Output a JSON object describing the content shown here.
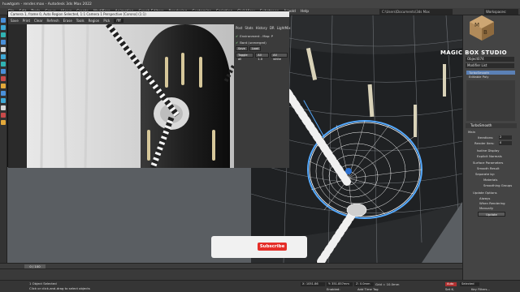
{
  "window": {
    "title": "huwtgom - render.max - Autodesk 3ds Max 2022",
    "menus": [
      "File",
      "Edit",
      "Tools",
      "Group",
      "Views",
      "Create",
      "Modifiers",
      "Animation",
      "Graph Editors",
      "Rendering",
      "Customize",
      "Scripting",
      "Civil View",
      "Substance",
      "Arnold",
      "Help"
    ],
    "project_path": "C:\\Users\\Documents\\3ds Max",
    "workspace": "Workspaces: Default"
  },
  "render_window": {
    "title": "Camera 1, frame 0, Auto Region Selected, 1:1 Camera 1 Perspective [Corona] (1:1)",
    "tools": [
      "Save",
      "Print",
      "Clear",
      "Refresh",
      "Erase",
      "Tools",
      "Region",
      "Pick"
    ],
    "pick_value": "ffff",
    "panel_tabs": [
      "Post",
      "Stats",
      "History",
      "DR",
      "LightMix"
    ],
    "rows": [
      "Environment - Map: P",
      "Bard (unmerged)"
    ],
    "buttons": [
      "Save",
      "Load"
    ],
    "buttons2": [
      "Toggle all",
      "All 1.0",
      "All white"
    ]
  },
  "logo": {
    "text": "MAGIC BOX STUDIO"
  },
  "command_panel": {
    "object_name": "Object074",
    "modifier_list": "Modifier List",
    "stack": [
      "TurboSmooth",
      "Editable Poly"
    ],
    "rollout_title": "TurboSmooth",
    "main_label": "Main",
    "iterations_label": "Iterations:",
    "iterations_value": "2",
    "render_iters_label": "Render Iters:",
    "render_iters_value": "0",
    "isoline_display": "Isoline Display",
    "explicit_normals": "Explicit Normals",
    "surface_params": "Surface Parameters",
    "smooth_result": "Smooth Result",
    "separate_by": "Separate by:",
    "materials": "Materials",
    "smoothing_groups": "Smoothing Groups",
    "update_options": "Update Options",
    "always": "Always",
    "when_rendering": "When Rendering",
    "manually": "Manually",
    "update_button": "Update"
  },
  "timeline": {
    "scrubber": "0 / 100"
  },
  "status": {
    "selected": "1 Object Selected",
    "prompt": "Click or click-and-drag to select objects",
    "x": "X: 1051.86",
    "y": "Y: 351.857mm",
    "z": "Z: 0.0mm",
    "grid": "Grid = 10.0mm",
    "add_time_tag": "Add Time Tag",
    "enabled": "Enabled:",
    "auto": "Auto",
    "selected_btn": "Selected",
    "set_key": "Set K.",
    "key_filters": "Key Filters..."
  },
  "overlay": {
    "subscribe": "Subscribe"
  },
  "colors": {
    "accent": "#e52d27",
    "wire": "#ffffff",
    "selection": "#55aaff"
  }
}
